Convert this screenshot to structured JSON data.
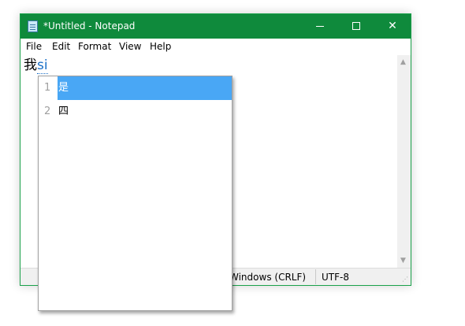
{
  "window": {
    "title": "*Untitled - Notepad",
    "accent_color": "#0f8a3c",
    "icons": {
      "app": "notepad-icon",
      "minimize": "minimize-icon",
      "maximize": "maximize-icon",
      "close": "close-icon"
    }
  },
  "menu": {
    "items": [
      "File",
      "Edit",
      "Format",
      "View",
      "Help"
    ]
  },
  "editor": {
    "committed_text": "我",
    "composing_text": "si"
  },
  "ime": {
    "highlight_color": "#49a7f5",
    "candidates": [
      {
        "number": "1",
        "text": "是",
        "selected": true
      },
      {
        "number": "2",
        "text": "四",
        "selected": false
      }
    ]
  },
  "status_bar": {
    "line_ending": "Windows (CRLF)",
    "encoding": "UTF-8"
  },
  "scrollbar": {
    "up_icon": "scroll-up-icon",
    "down_icon": "scroll-down-icon"
  }
}
